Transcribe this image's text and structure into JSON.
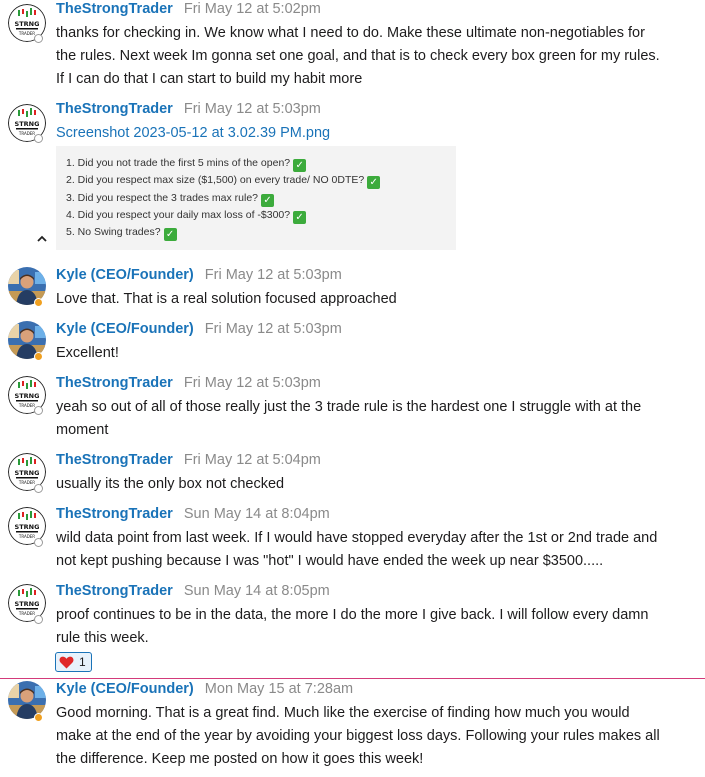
{
  "accent": "#1a73b8",
  "new_divider_color": "#d33a7a",
  "messages": [
    {
      "author": "TheStrongTrader",
      "time": "Fri May 12 at 5:02pm",
      "lines": [
        "thanks for checking in. We know what I need to do. Make these ultimate non-negotiables for",
        "the rules. Next week Im gonna set one goal, and that is to check every box green for my rules.",
        "If I can do that I can start to build my habit more"
      ]
    },
    {
      "author": "TheStrongTrader",
      "time": "Fri May 12 at 5:03pm",
      "attachment_name": "Screenshot 2023-05-12 at 3.02.39 PM.png",
      "attachment_items": [
        "1. Did you not trade the first 5 mins of the open?",
        "2. Did you respect max size ($1,500) on every trade/ NO 0DTE?",
        "3. Did you respect the 3 trades max rule?",
        "4. Did you respect your daily max loss of -$300?",
        "5. No Swing trades?"
      ]
    },
    {
      "author": "Kyle (CEO/Founder)",
      "time": "Fri May 12 at 5:03pm",
      "lines": [
        "Love that. That is a real solution focused approached"
      ]
    },
    {
      "author": "Kyle (CEO/Founder)",
      "time": "Fri May 12 at 5:03pm",
      "lines": [
        "Excellent!"
      ]
    },
    {
      "author": "TheStrongTrader",
      "time": "Fri May 12 at 5:03pm",
      "lines": [
        "yeah so out of all of those really just the 3 trade rule is the hardest one I struggle with at the",
        "moment"
      ]
    },
    {
      "author": "TheStrongTrader",
      "time": "Fri May 12 at 5:04pm",
      "lines": [
        "usually its the only box not checked"
      ]
    },
    {
      "author": "TheStrongTrader",
      "time": "Sun May 14 at 8:04pm",
      "lines": [
        "wild data point from last week. If I would have stopped everyday after the 1st or 2nd trade and",
        "not kept pushing because I was \"hot\" I would have ended the week up near $3500....."
      ]
    },
    {
      "author": "TheStrongTrader",
      "time": "Sun May 14 at 8:05pm",
      "lines": [
        "proof continues to be in the data, the more I do the more I give back. I will follow every damn",
        "rule this week."
      ],
      "reaction": {
        "icon": "heart-icon",
        "count": "1"
      }
    },
    {
      "author": "Kyle (CEO/Founder)",
      "time": "Mon May 15 at 7:28am",
      "lines": [
        "Good morning. That is a great find. Much like the exercise of finding how much you would",
        "make at the end of the year by avoiding your biggest loss days. Following your rules makes all",
        "the difference. Keep me posted on how it goes this week!"
      ]
    }
  ]
}
